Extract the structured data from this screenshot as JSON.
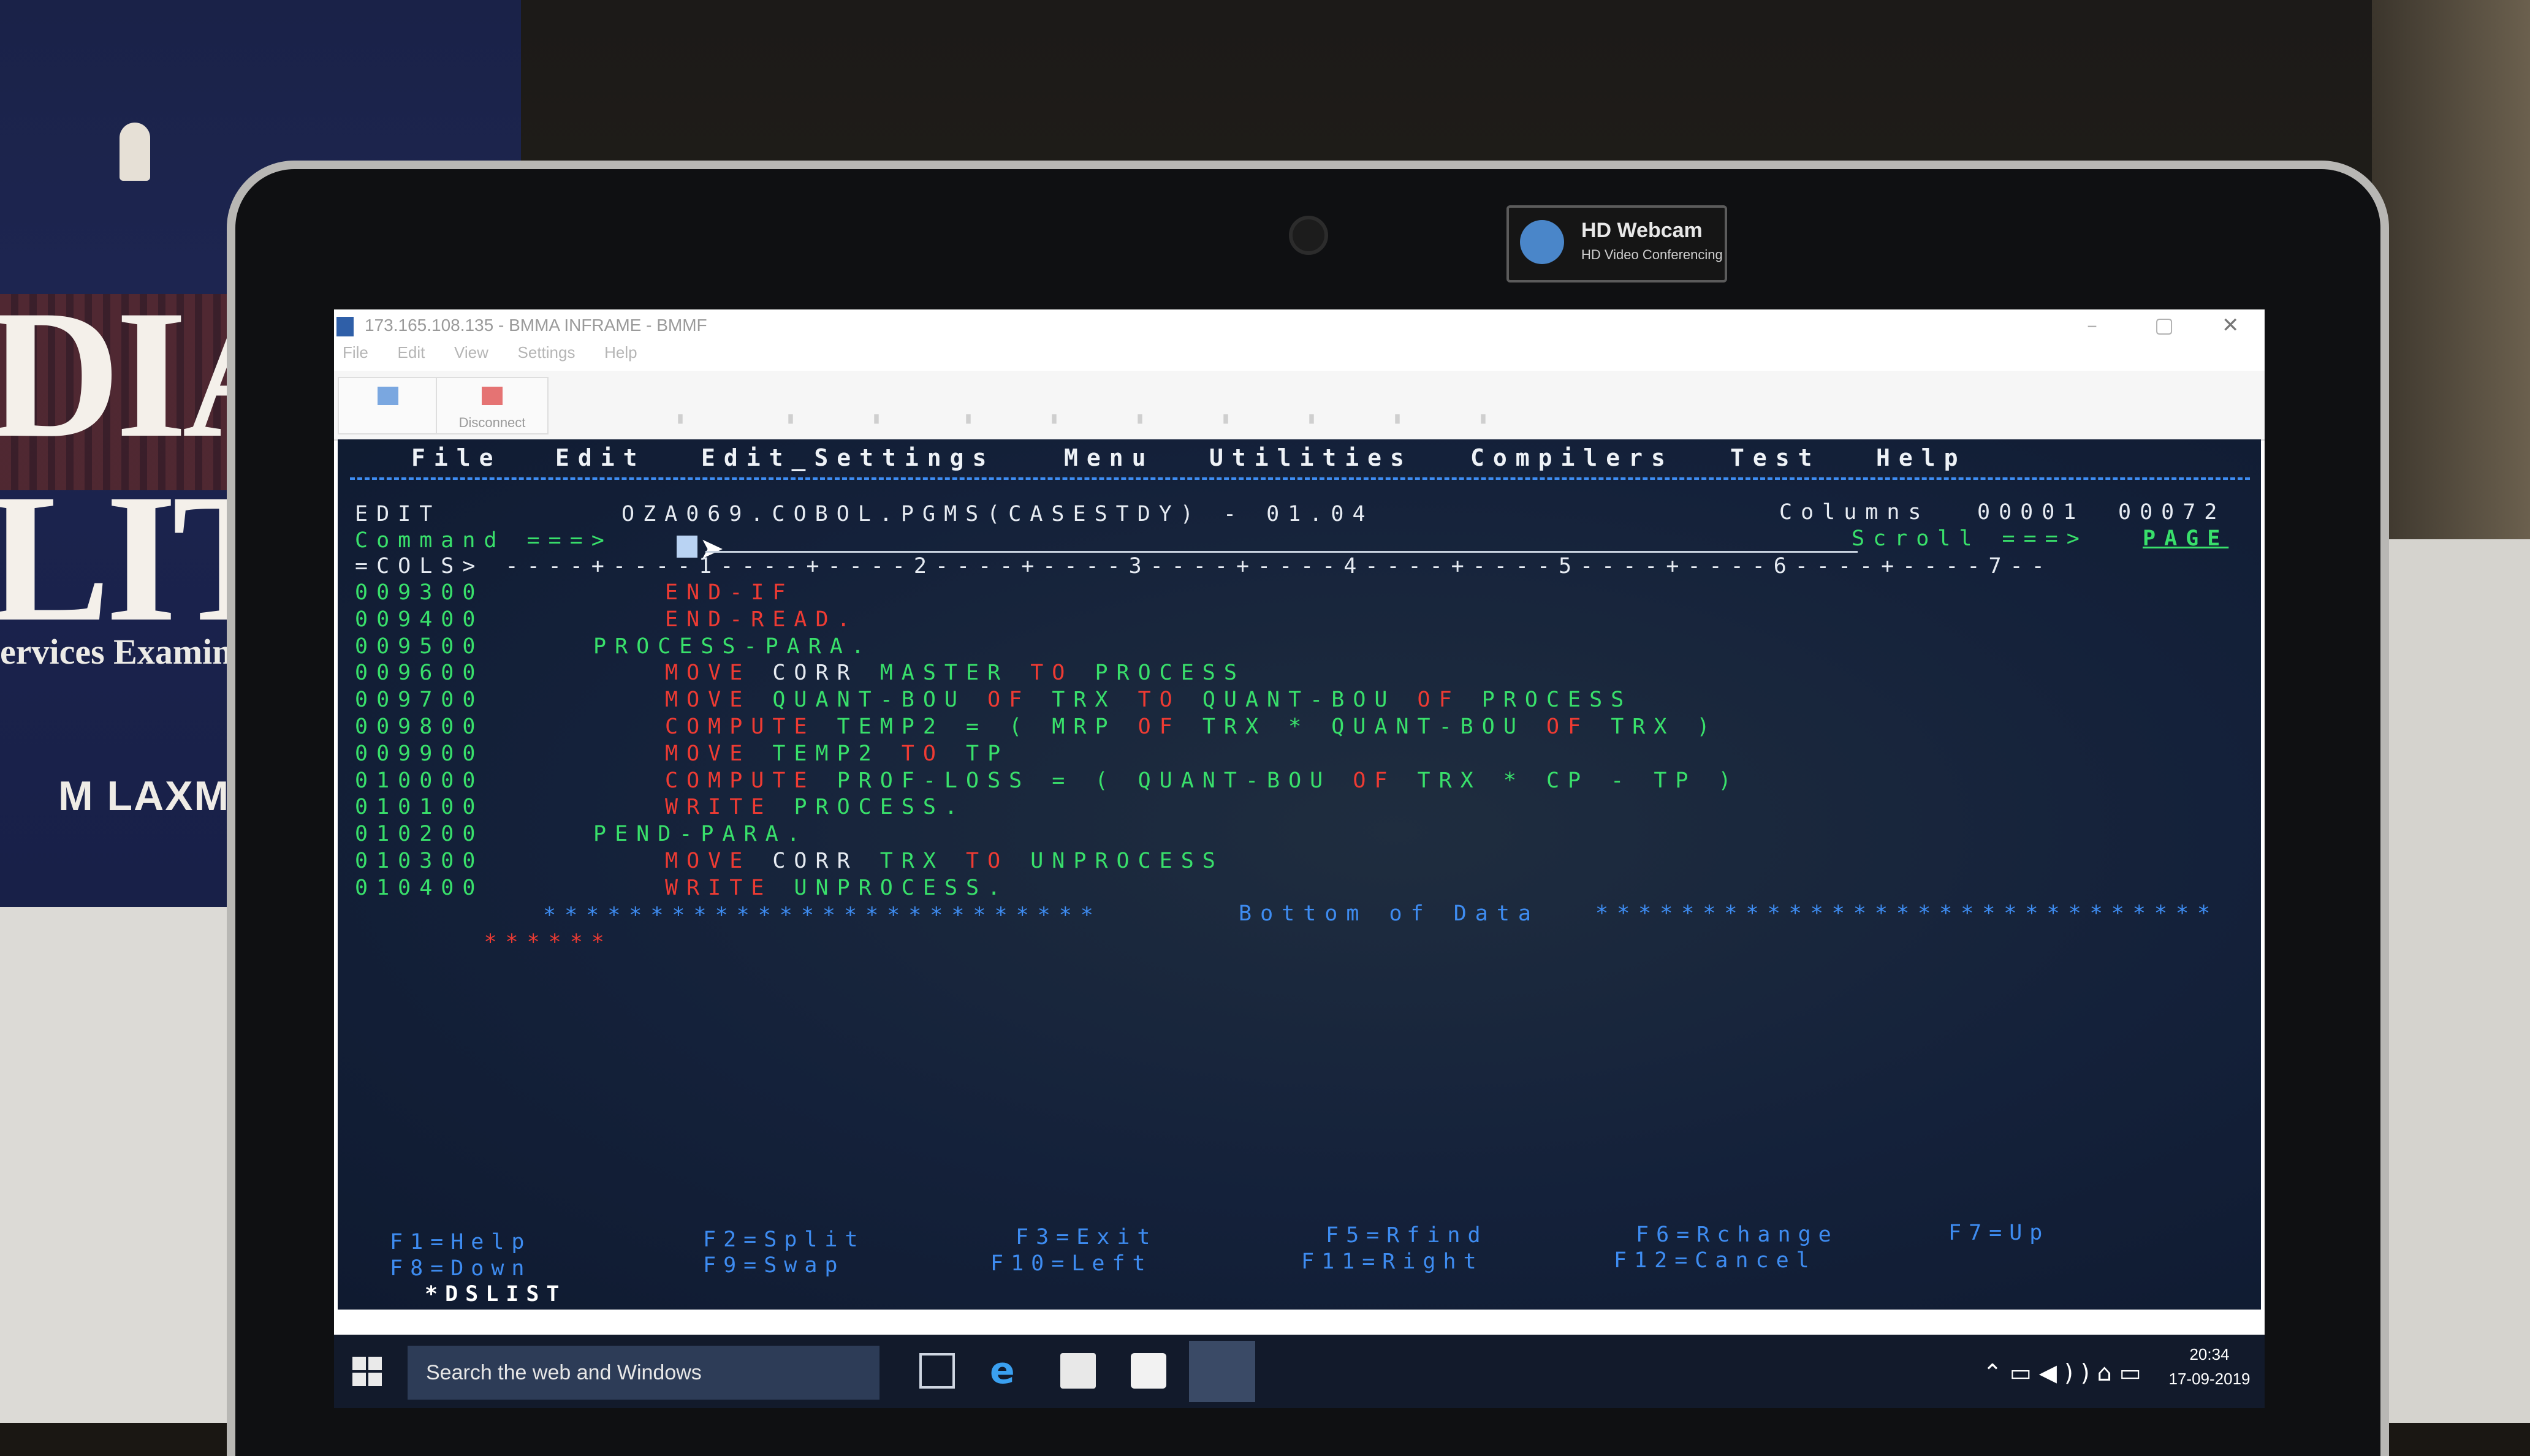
{
  "book": {
    "title_lines": [
      "DIA",
      "LIT"
    ],
    "subtitle": "ervices Examinat",
    "author": "M LAXMI"
  },
  "webcam_sticker": {
    "title": "HD Webcam",
    "subtitle": "HD Video Conferencing"
  },
  "window": {
    "title": "173.165.108.135 - BMMA INFRAME - BMMF",
    "menu": [
      "File",
      "Edit",
      "View",
      "Settings",
      "Help"
    ],
    "toolbar": {
      "connect_label": "",
      "disconnect_label": "Disconnect"
    }
  },
  "ispf": {
    "action_bar": [
      "File",
      "Edit",
      "Edit_Settings",
      "Menu",
      "Utilities",
      "Compilers",
      "Test",
      "Help"
    ],
    "header": {
      "mode": "EDIT",
      "dataset": "OZA069.COBOL.PGMS(CASESTDY) - 01.04",
      "columns_label": "Columns",
      "col_from": "00001",
      "col_to": "00072",
      "command_label": "Command ===>",
      "command_value": "",
      "scroll_label": "Scroll ===>",
      "scroll_value": "PAGE"
    },
    "cols_ruler": "=COLS> ----+----1----+----2----+----3----+----4----+----5----+----6----+----7--",
    "lines": [
      {
        "num": "009300",
        "indent": 6,
        "tokens": [
          [
            "r",
            "END-IF"
          ]
        ]
      },
      {
        "num": "009400",
        "indent": 6,
        "tokens": [
          [
            "r",
            "END-READ."
          ]
        ]
      },
      {
        "num": "009500",
        "indent": 3,
        "tokens": [
          [
            "g",
            "PROCESS-PARA."
          ]
        ]
      },
      {
        "num": "009600",
        "indent": 6,
        "tokens": [
          [
            "r",
            "MOVE "
          ],
          [
            "w",
            "CORR "
          ],
          [
            "g",
            "MASTER "
          ],
          [
            "r",
            "TO "
          ],
          [
            "g",
            "PROCESS"
          ]
        ]
      },
      {
        "num": "009700",
        "indent": 6,
        "tokens": [
          [
            "r",
            "MOVE "
          ],
          [
            "g",
            "QUANT-BOU "
          ],
          [
            "r",
            "OF "
          ],
          [
            "g",
            "TRX "
          ],
          [
            "r",
            "TO "
          ],
          [
            "g",
            "QUANT-BOU "
          ],
          [
            "r",
            "OF "
          ],
          [
            "g",
            "PROCESS"
          ]
        ]
      },
      {
        "num": "009800",
        "indent": 6,
        "tokens": [
          [
            "r",
            "COMPUTE "
          ],
          [
            "g",
            "TEMP2 = ( MRP "
          ],
          [
            "r",
            "OF "
          ],
          [
            "g",
            "TRX * QUANT-BOU "
          ],
          [
            "r",
            "OF "
          ],
          [
            "g",
            "TRX )"
          ]
        ]
      },
      {
        "num": "009900",
        "indent": 6,
        "tokens": [
          [
            "r",
            "MOVE "
          ],
          [
            "g",
            "TEMP2 "
          ],
          [
            "r",
            "TO "
          ],
          [
            "g",
            "TP"
          ]
        ]
      },
      {
        "num": "010000",
        "indent": 6,
        "tokens": [
          [
            "r",
            "COMPUTE "
          ],
          [
            "g",
            "PROF-LOSS = ( QUANT-BOU "
          ],
          [
            "r",
            "OF "
          ],
          [
            "g",
            "TRX * CP - TP )"
          ]
        ]
      },
      {
        "num": "010100",
        "indent": 6,
        "tokens": [
          [
            "r",
            "WRITE "
          ],
          [
            "g",
            "PROCESS."
          ]
        ]
      },
      {
        "num": "010200",
        "indent": 3,
        "tokens": [
          [
            "g",
            "PEND-PARA."
          ]
        ]
      },
      {
        "num": "010300",
        "indent": 6,
        "tokens": [
          [
            "r",
            "MOVE "
          ],
          [
            "w",
            "CORR "
          ],
          [
            "g",
            "TRX "
          ],
          [
            "r",
            "TO "
          ],
          [
            "g",
            "UNPROCESS"
          ]
        ]
      },
      {
        "num": "010400",
        "indent": 6,
        "tokens": [
          [
            "r",
            "WRITE "
          ],
          [
            "g",
            "UNPROCESS."
          ]
        ]
      }
    ],
    "bottom_marker": {
      "left": "******",
      "stars_left": "**************************",
      "text": "Bottom of Data",
      "stars_right": "*****************************"
    },
    "function_keys": {
      "row1": [
        "F1=Help",
        "F2=Split",
        "F3=Exit",
        "F5=Rfind",
        "F6=Rchange",
        "F7=Up"
      ],
      "row2": [
        "F8=Down",
        "F9=Swap",
        "F10=Left",
        "F11=Right",
        "F12=Cancel"
      ],
      "footer": "*DSLIST"
    }
  },
  "taskbar": {
    "search_placeholder": "Search the web and Windows",
    "time": "20:34",
    "date": "17-09-2019"
  },
  "colors": {
    "terminal_bg": "#14213a",
    "white": "#e6ebf2",
    "green": "#39e06b",
    "red": "#ee3b33",
    "blue": "#3e8cf1"
  }
}
